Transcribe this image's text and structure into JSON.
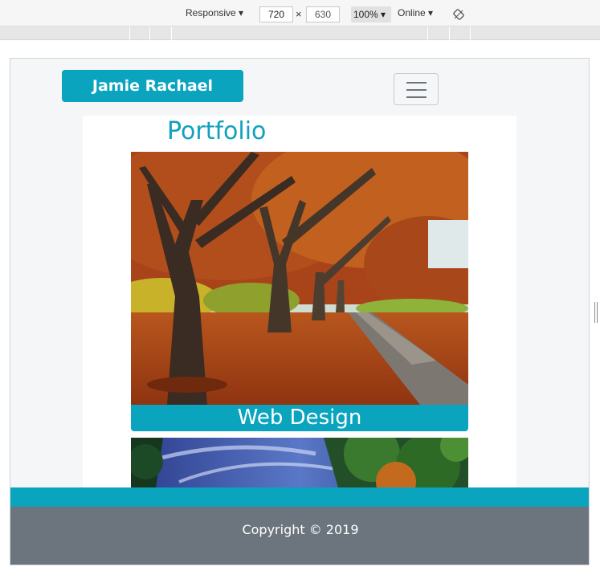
{
  "devtools": {
    "device_label": "Responsive ▾",
    "width_value": "720",
    "times": "×",
    "height_value": "630",
    "zoom_label": "100% ▾",
    "network_label": "Online ▾",
    "rotate_icon": "rotate-icon"
  },
  "site": {
    "brand": "Jamie Rachael",
    "menu_icon": "hamburger-icon",
    "section_title": "Portfolio",
    "items": [
      {
        "caption": "Web Design",
        "image": "autumn-tree-path-photo"
      },
      {
        "caption": "",
        "image": "night-sky-trees-photo"
      }
    ],
    "footer_text": "Copyright © 2019"
  },
  "colors": {
    "accent": "#0aa4bf",
    "title": "#10a1bc",
    "footer": "#6c757d"
  }
}
